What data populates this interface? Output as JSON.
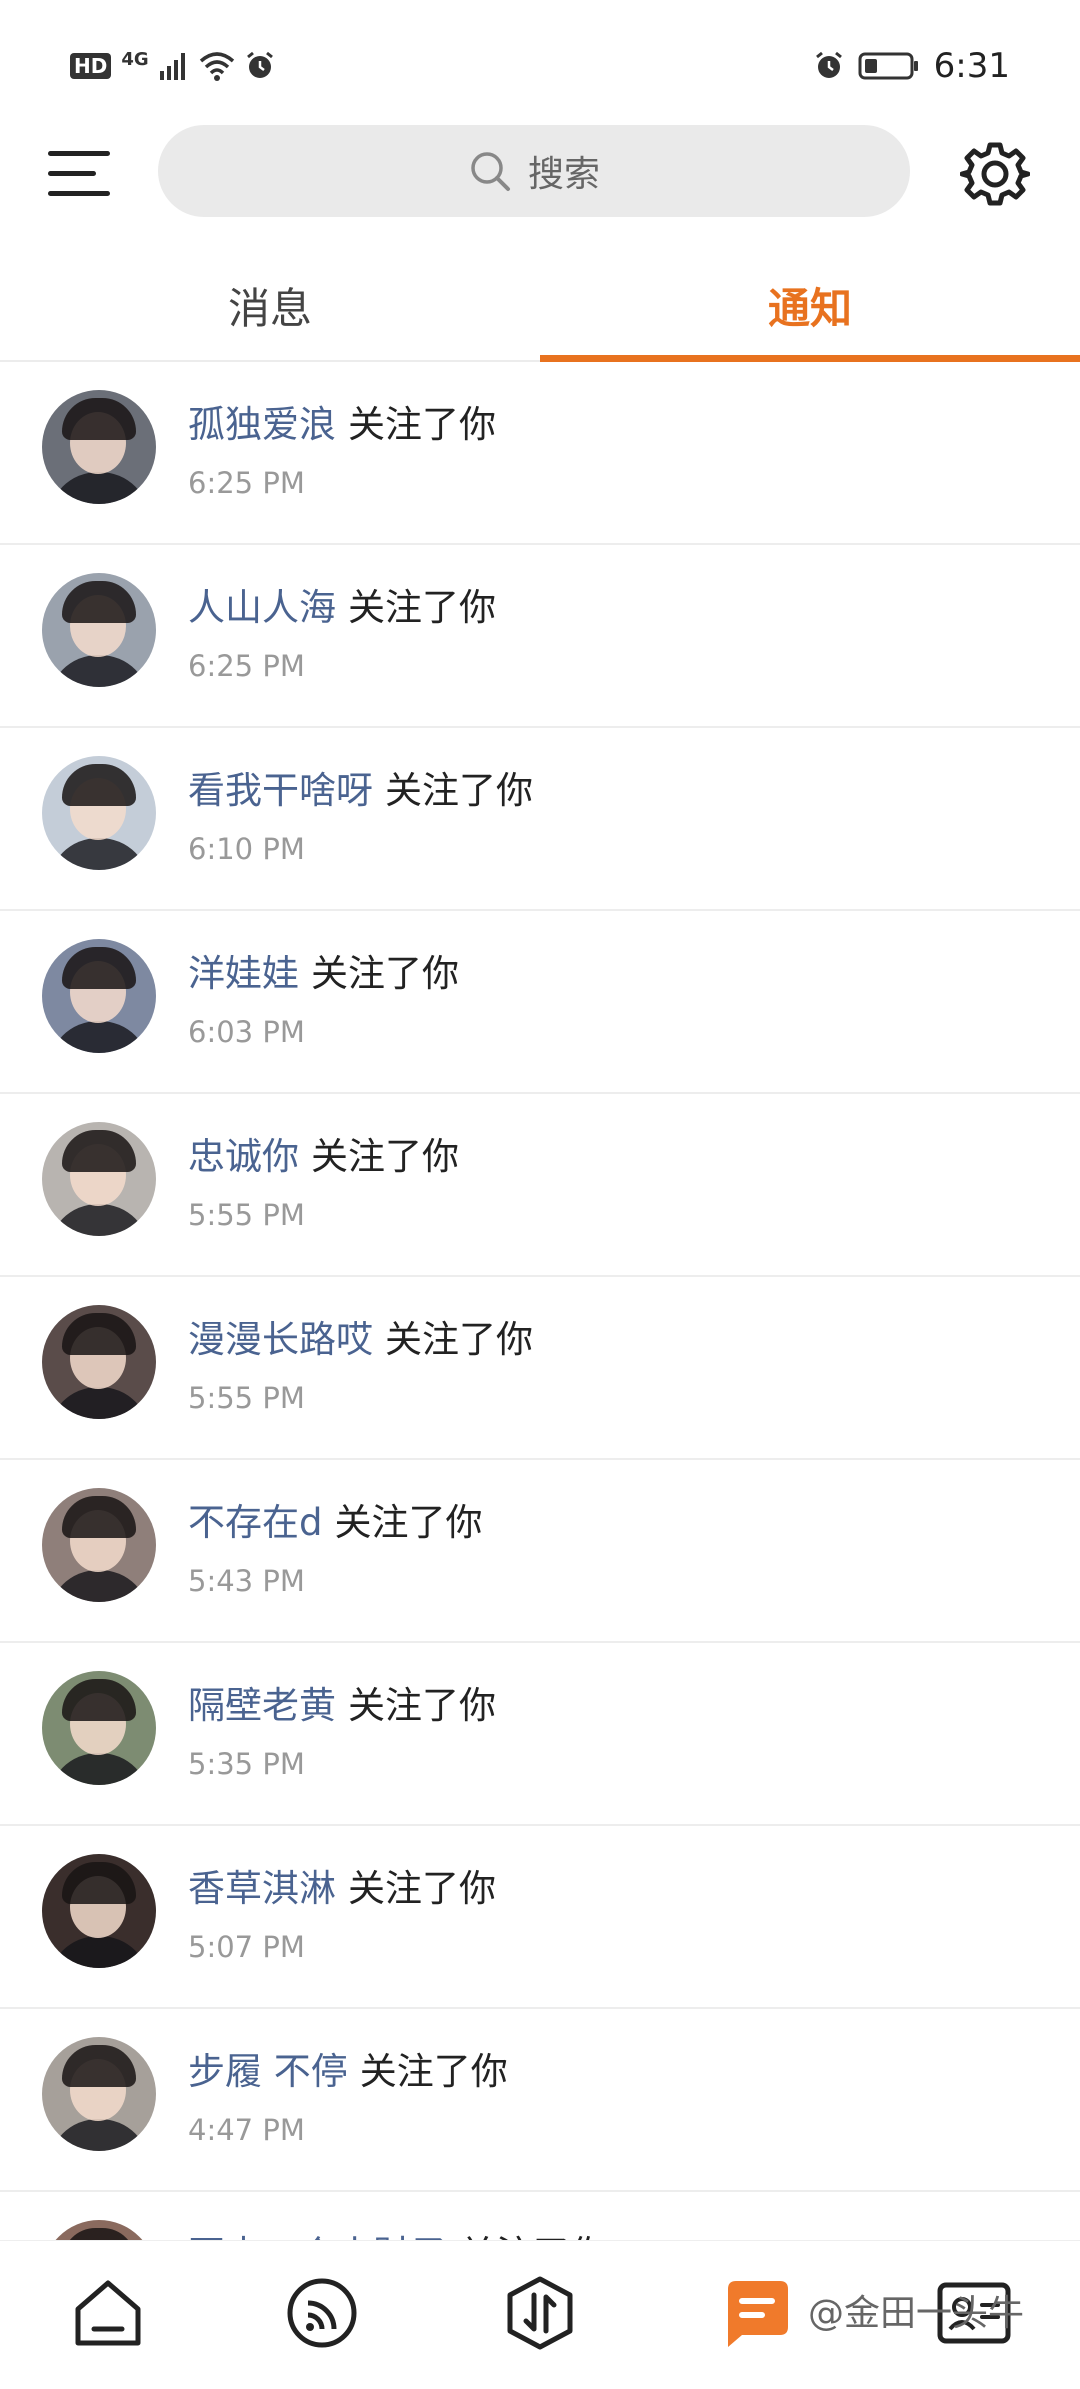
{
  "status_bar": {
    "hd": "HD",
    "network": "4G",
    "time": "6:31"
  },
  "search": {
    "placeholder": "搜索"
  },
  "tabs": [
    {
      "label": "消息",
      "active": false
    },
    {
      "label": "通知",
      "active": true
    }
  ],
  "colors": {
    "accent": "#e8721f",
    "username": "#4a6390",
    "timestamp": "#999999"
  },
  "notifications": [
    {
      "user": "孤独爱浪",
      "action": "关注了你",
      "time": "6:25 PM",
      "avatar": "#6b6f78"
    },
    {
      "user": "人山人海",
      "action": "关注了你",
      "time": "6:25 PM",
      "avatar": "#9aa2ad"
    },
    {
      "user": "看我干啥呀",
      "action": "关注了你",
      "time": "6:10 PM",
      "avatar": "#c4cdd8"
    },
    {
      "user": "洋娃娃",
      "action": "关注了你",
      "time": "6:03 PM",
      "avatar": "#7e89a1"
    },
    {
      "user": "忠诚你",
      "action": "关注了你",
      "time": "5:55 PM",
      "avatar": "#b8b4b0"
    },
    {
      "user": "漫漫长路哎",
      "action": "关注了你",
      "time": "5:55 PM",
      "avatar": "#5a4c4a"
    },
    {
      "user": "不存在d",
      "action": "关注了你",
      "time": "5:43 PM",
      "avatar": "#8f7f7a"
    },
    {
      "user": "隔壁老黄",
      "action": "关注了你",
      "time": "5:35 PM",
      "avatar": "#7d8c72"
    },
    {
      "user": "香草淇淋",
      "action": "关注了你",
      "time": "5:07 PM",
      "avatar": "#3a2e2c"
    },
    {
      "user": "步履 不停",
      "action": "关注了你",
      "time": "4:47 PM",
      "avatar": "#a6a09a"
    },
    {
      "user": "再来一个小财子",
      "action": "关注了你",
      "time": "",
      "avatar": "#8a6a5e"
    }
  ],
  "bottom_nav": [
    {
      "name": "home-icon"
    },
    {
      "name": "feed-icon"
    },
    {
      "name": "trade-icon"
    },
    {
      "name": "message-icon",
      "active": true
    },
    {
      "name": "profile-card-icon"
    }
  ],
  "watermark": "@金田一头牛"
}
